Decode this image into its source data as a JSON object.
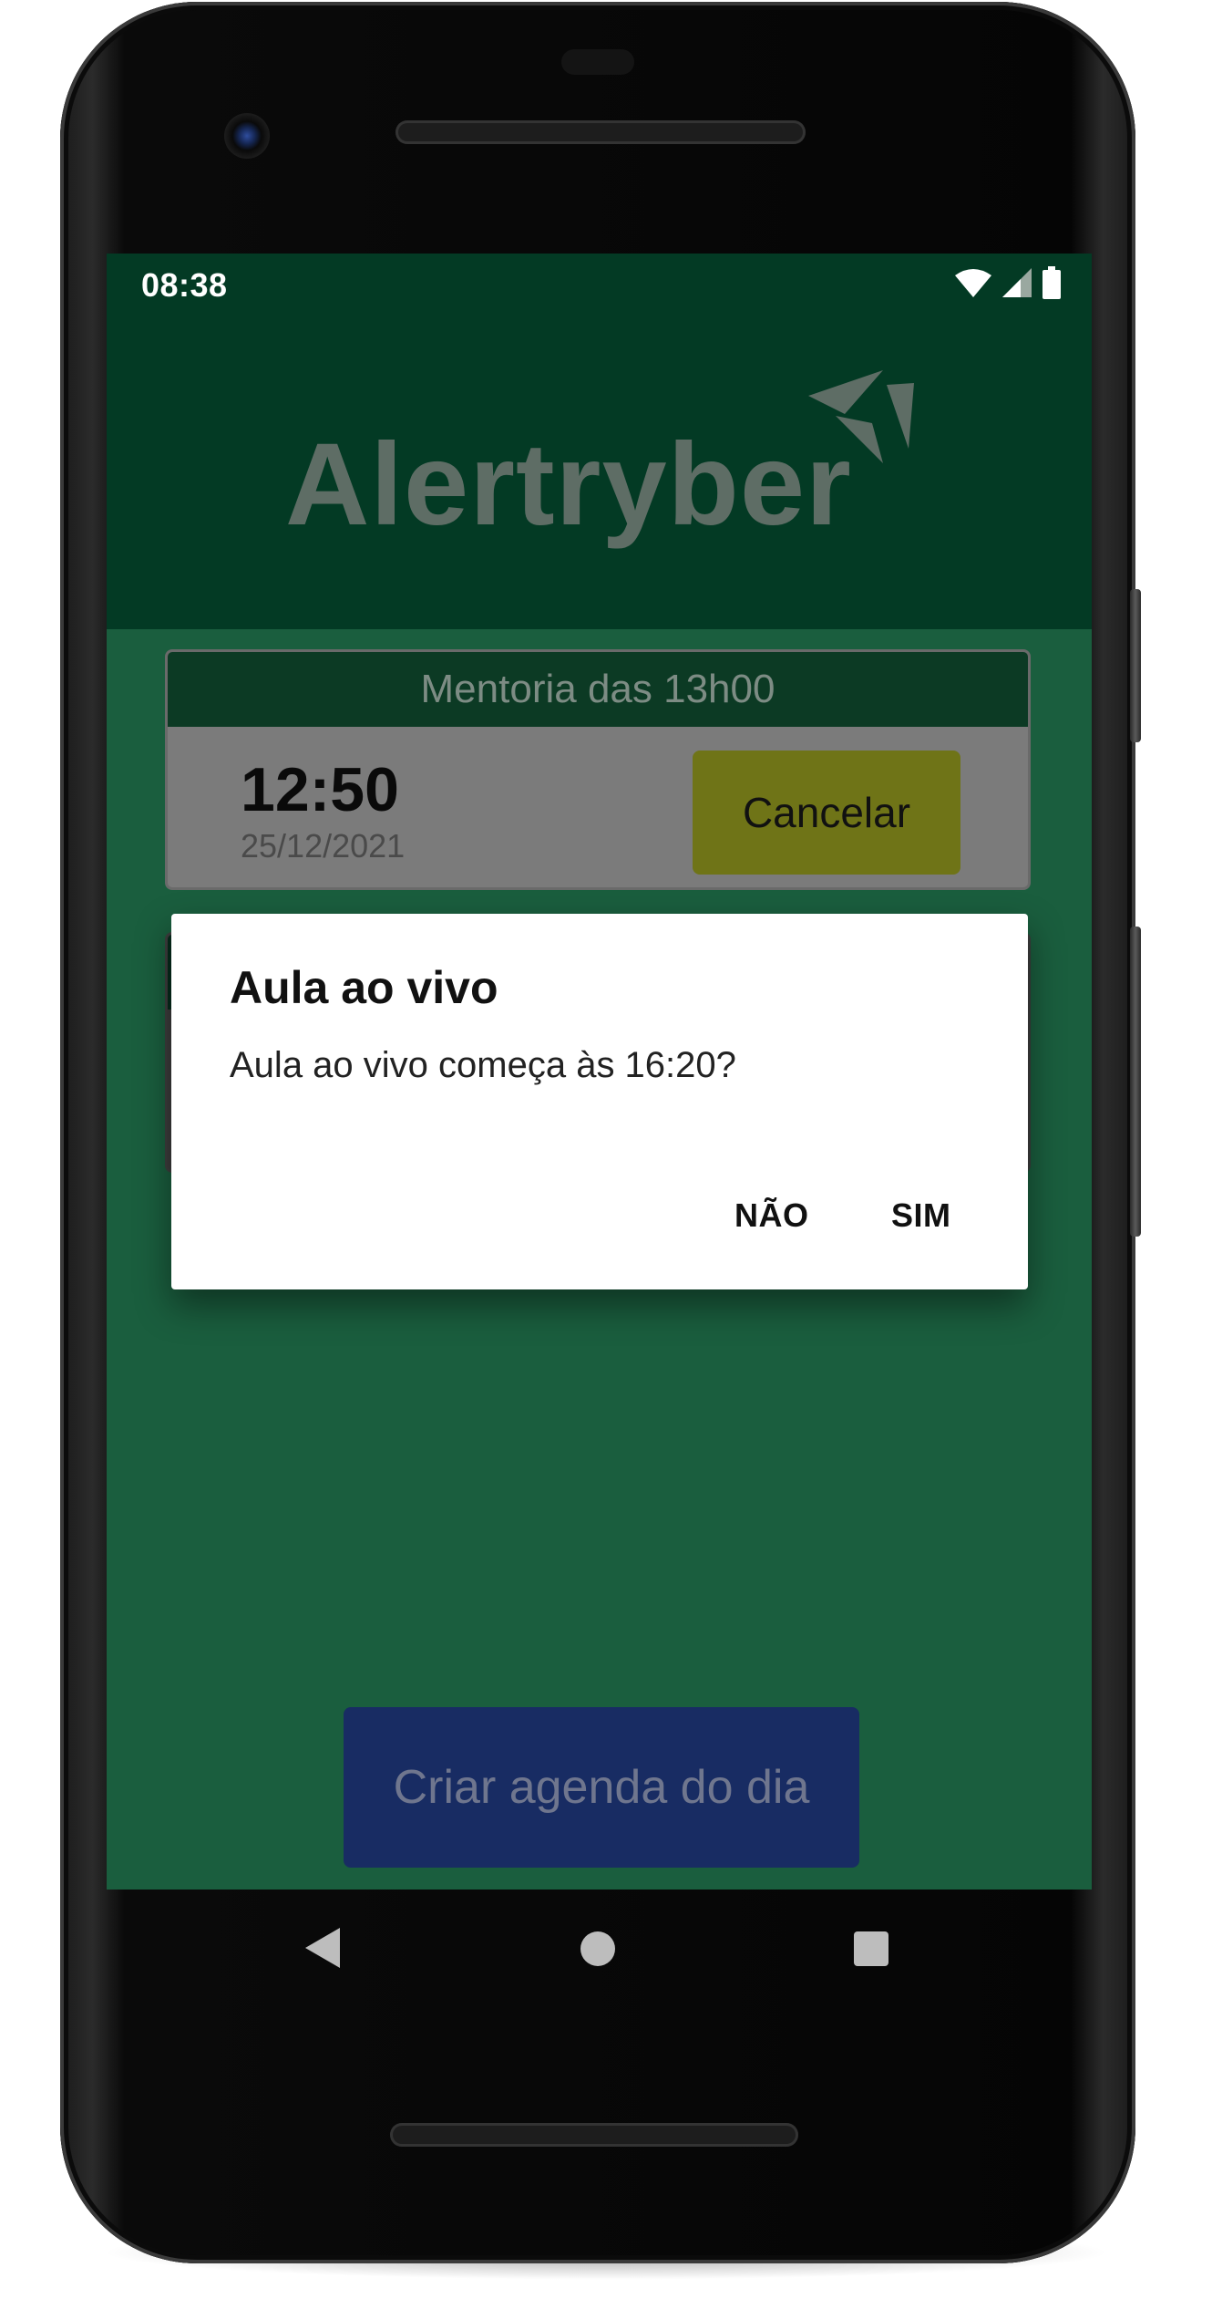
{
  "status_bar": {
    "time": "08:38"
  },
  "app": {
    "logo_text": "Alertryber",
    "colors": {
      "background": "#1a5e3e",
      "header": "#033a24",
      "cancel_button": "#6f7417",
      "create_button": "#182c63"
    }
  },
  "schedule": {
    "cards": [
      {
        "title": "Mentoria das 13h00",
        "time": "12:50",
        "date": "25/12/2021",
        "cancel_label": "Cancelar"
      }
    ]
  },
  "dialog": {
    "title": "Aula ao vivo",
    "message": "Aula ao vivo começa às 16:20?",
    "negative_label": "NÃO",
    "positive_label": "SIM"
  },
  "footer": {
    "create_label": "Criar agenda do dia"
  },
  "nav": {
    "back_icon": "back-triangle-icon",
    "home_icon": "home-circle-icon",
    "recents_icon": "recents-square-icon"
  }
}
